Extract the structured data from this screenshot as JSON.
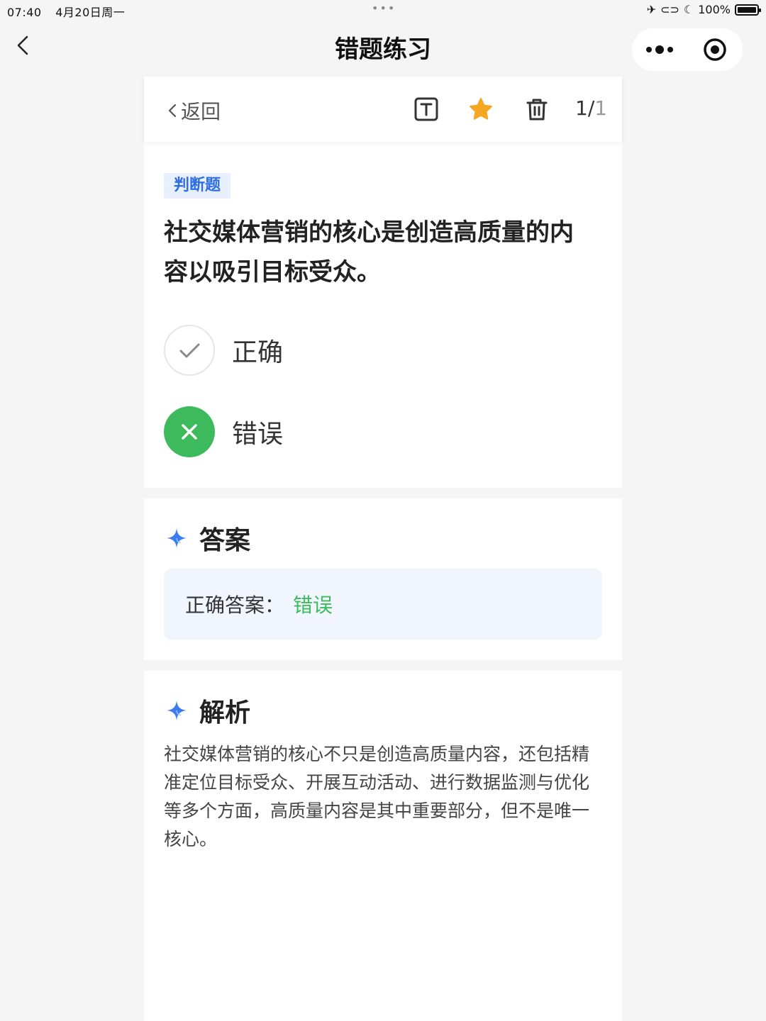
{
  "status_bar": {
    "time": "07:40",
    "date": "4月20日周一",
    "battery": "100%"
  },
  "nav": {
    "title": "错题练习"
  },
  "toolbar": {
    "back_label": "返回",
    "counter_current": "1/",
    "counter_total": "1",
    "icons": [
      "text-format-icon",
      "star-icon",
      "trash-icon"
    ],
    "star_color": "#f5a623"
  },
  "question": {
    "type_tag": "判断题",
    "text": "社交媒体营销的核心是创造高质量的内容以吸引目标受众。",
    "options": [
      {
        "label": "正确",
        "state": "unselected"
      },
      {
        "label": "错误",
        "state": "selected"
      }
    ]
  },
  "answer": {
    "title": "答案",
    "label": "正确答案：",
    "value": "错误"
  },
  "analysis": {
    "title": "解析",
    "text": "社交媒体营销的核心不只是创造高质量内容，还包括精准定位目标受众、开展互动活动、进行数据监测与优化等多个方面，高质量内容是其中重要部分，但不是唯一核心。"
  },
  "colors": {
    "accent_green": "#3dbb5c",
    "tag_blue": "#2f6ee0",
    "sparkle_blue": "#3a7bf0"
  }
}
